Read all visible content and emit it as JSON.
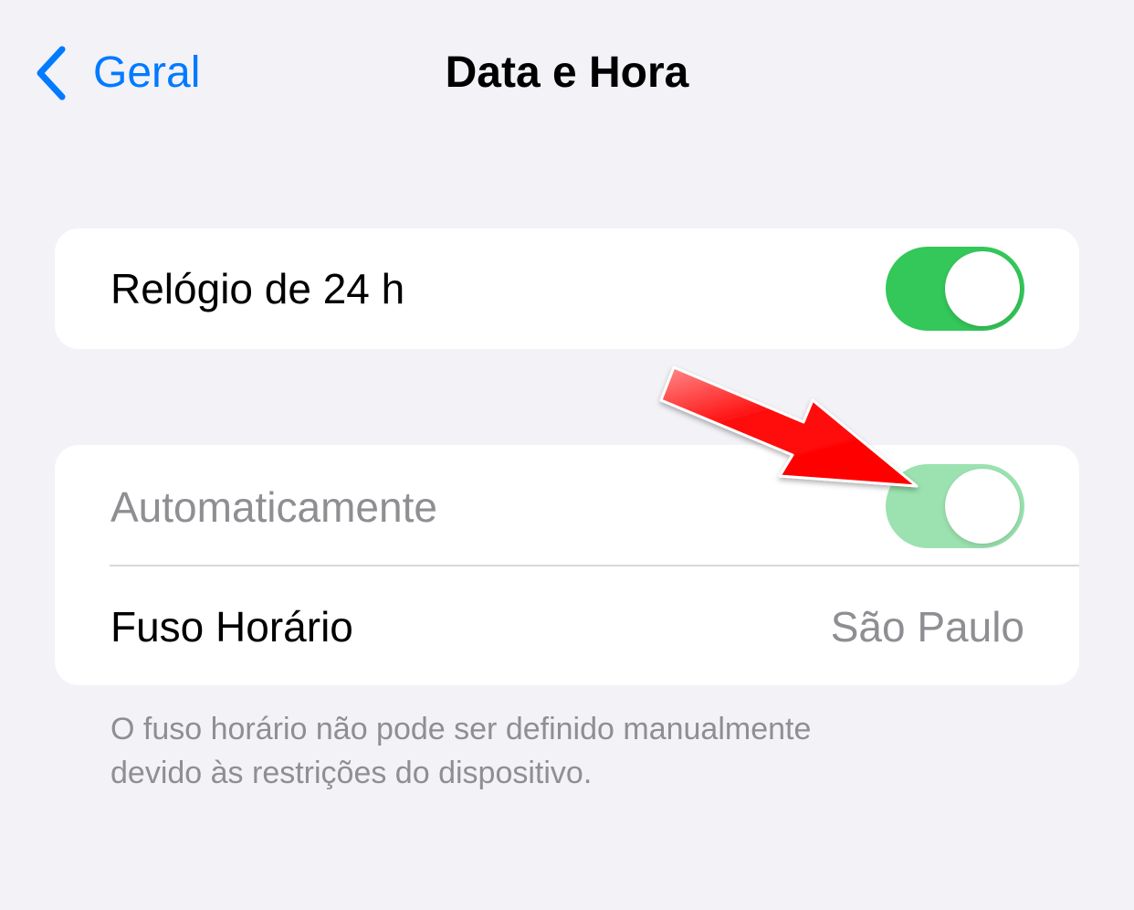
{
  "nav": {
    "back_label": "Geral",
    "title": "Data e Hora"
  },
  "settings": {
    "clock_24h": {
      "label": "Relógio de 24 h",
      "enabled": true
    },
    "automatic": {
      "label": "Automaticamente",
      "enabled": true,
      "disabled_state": true
    },
    "timezone": {
      "label": "Fuso Horário",
      "value": "São Paulo"
    }
  },
  "footer": {
    "line1": "O fuso horário não pode ser definido manualmente",
    "line2": "devido às restrições do dispositivo."
  },
  "colors": {
    "accent": "#007aff",
    "toggle_on": "#34c759",
    "toggle_on_disabled": "#9be2b0",
    "annotation_arrow": "#ff0000",
    "background": "#f2f2f7"
  }
}
